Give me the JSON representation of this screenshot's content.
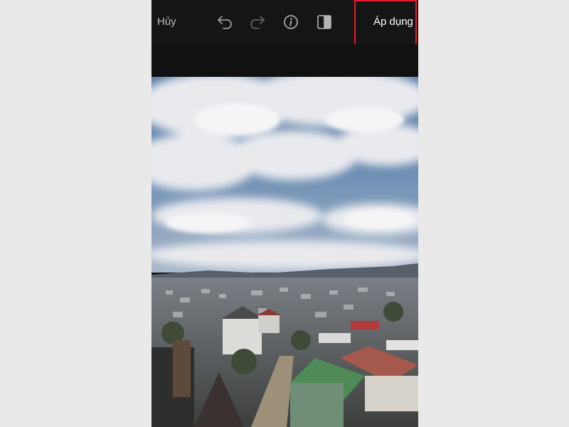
{
  "toolbar": {
    "cancel_label": "Hủy",
    "apply_label": "Áp dụng",
    "icons": [
      "undo-icon",
      "redo-icon",
      "info-icon",
      "compare-icon"
    ],
    "highlight_color": "#e11d2a"
  },
  "photo": {
    "subject": "cityscape-under-cloudy-sky"
  }
}
